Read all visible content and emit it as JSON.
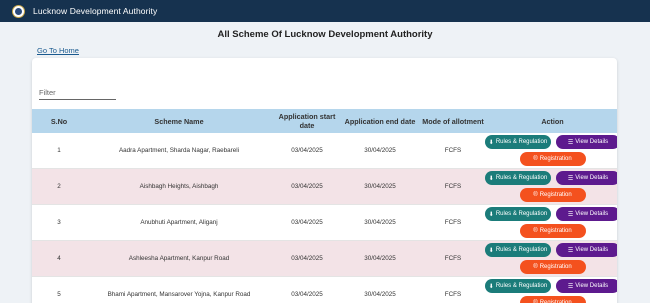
{
  "header": {
    "brand": "Lucknow Development Authority"
  },
  "page": {
    "title": "All Scheme Of Lucknow Development Authority",
    "home_link": "Go To Home"
  },
  "filter": {
    "placeholder": "Filter"
  },
  "table": {
    "columns": [
      "S.No",
      "Scheme Name",
      "Application start date",
      "Application end date",
      "Mode of allotment",
      "Action"
    ],
    "rows": [
      {
        "sno": "1",
        "name": "Aadra Apartment, Sharda Nagar, Raebareli",
        "start": "03/04/2025",
        "end": "30/04/2025",
        "mode": "FCFS"
      },
      {
        "sno": "2",
        "name": "Aishbagh Heights, Aishbagh",
        "start": "03/04/2025",
        "end": "30/04/2025",
        "mode": "FCFS"
      },
      {
        "sno": "3",
        "name": "Anubhuti Apartment, Aliganj",
        "start": "03/04/2025",
        "end": "30/04/2025",
        "mode": "FCFS"
      },
      {
        "sno": "4",
        "name": "Ashleesha Apartment, Kanpur Road",
        "start": "03/04/2025",
        "end": "30/04/2025",
        "mode": "FCFS"
      },
      {
        "sno": "5",
        "name": "Bhami Apartment, Mansarover Yojna, Kanpur Road",
        "start": "03/04/2025",
        "end": "30/04/2025",
        "mode": "FCFS"
      }
    ],
    "actions": {
      "rules": "Rules & Regulation",
      "view": "View Details",
      "register": "Registration"
    }
  },
  "icons": {
    "rules": "download-icon",
    "view": "list-icon",
    "register": "registered-icon"
  },
  "colors": {
    "header_bg": "#16324f",
    "table_head": "#b5d6ec",
    "row_alt": "#f3e3e7",
    "rules_btn": "#1b7c7a",
    "view_btn": "#5d1a8e",
    "register_btn": "#f4511e"
  }
}
